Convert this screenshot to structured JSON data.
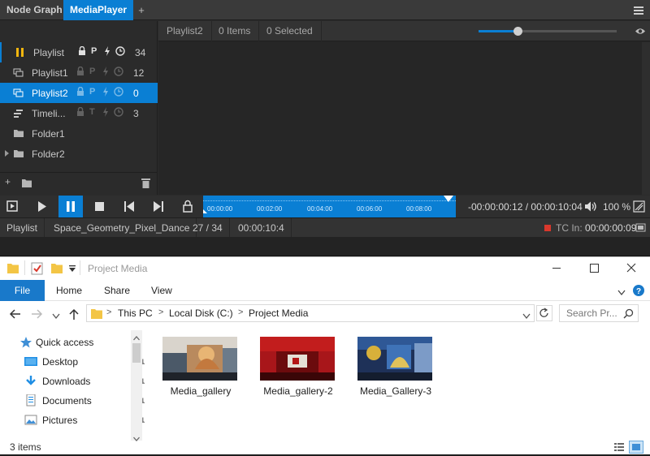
{
  "app": {
    "tabs": [
      {
        "label": "Node Graph",
        "active": false
      },
      {
        "label": "MediaPlayer",
        "active": true
      }
    ],
    "add_tab_label": "+",
    "accent_color": "#0a7fd4",
    "sidebar": {
      "items": [
        {
          "label": "Playlist",
          "count": "34",
          "flags": [
            "lock",
            "P",
            "bolt",
            "clock"
          ],
          "icon": "pause-icon",
          "active": true
        },
        {
          "label": "Playlist1",
          "count": "12",
          "flags": [
            "lock",
            "P",
            "bolt",
            "clock"
          ],
          "icon": "playlist-icon"
        },
        {
          "label": "Playlist2",
          "count": "0",
          "flags": [
            "lock",
            "P",
            "bolt",
            "clock"
          ],
          "icon": "playlist-icon",
          "selected": true
        },
        {
          "label": "Timeli...",
          "count": "3",
          "flags": [
            "lock",
            "T",
            "bolt",
            "clock"
          ],
          "icon": "timeline-icon"
        },
        {
          "label": "Folder1",
          "icon": "folder-icon"
        },
        {
          "label": "Folder2",
          "icon": "folder-icon",
          "expandable": true
        }
      ]
    },
    "main_header": {
      "playlist_name": "Playlist2",
      "items": "0 Items",
      "selected": "0 Selected",
      "zoom_fraction": 0.28
    },
    "transport": {
      "timeline_marks": [
        "00:00:00",
        "00:02:00",
        "00:04:00",
        "00:06:00",
        "00:08:00"
      ],
      "timecode": "-00:00:00:12 / 00:00:10:04",
      "volume": "100 %"
    },
    "statusbar": {
      "mode": "Playlist",
      "clip": "Space_Geometry_Pixel_Dance",
      "position": "27 / 34",
      "duration": "00:00:10:4",
      "tc_in_label": "TC In:",
      "tc_in_value": "00:00:00:09"
    }
  },
  "explorer": {
    "title": "Project Media",
    "ribbon_tabs": [
      "File",
      "Home",
      "Share",
      "View"
    ],
    "breadcrumb": [
      "This PC",
      "Local Disk (C:)",
      "Project Media"
    ],
    "search_placeholder": "Search Pr...",
    "nav": [
      {
        "label": "Quick access",
        "icon": "star-icon"
      },
      {
        "label": "Desktop",
        "icon": "desktop-icon",
        "pinned": true
      },
      {
        "label": "Downloads",
        "icon": "download-icon",
        "pinned": true
      },
      {
        "label": "Documents",
        "icon": "documents-icon",
        "pinned": true
      },
      {
        "label": "Pictures",
        "icon": "pictures-icon",
        "pinned": true
      }
    ],
    "files": [
      {
        "name": "Media_gallery"
      },
      {
        "name": "Media_gallery-2"
      },
      {
        "name": "Media_Gallery-3"
      }
    ],
    "status": "3 items"
  }
}
